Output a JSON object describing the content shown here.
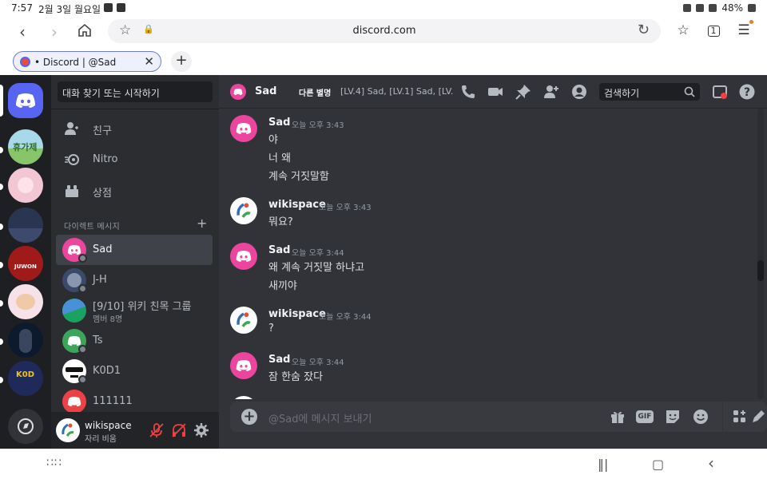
{
  "status_bar": {
    "time": "7:57",
    "date": "2월 3일 월요일",
    "battery": "48%"
  },
  "browser": {
    "url": "discord.com",
    "tab_title": "• Discord | @Sad",
    "tab_count": "1"
  },
  "dm_sidebar": {
    "search_placeholder": "대화 찾기 또는 시작하기",
    "nav": [
      {
        "label": "친구",
        "icon": "friends-icon"
      },
      {
        "label": "Nitro",
        "icon": "nitro-icon"
      },
      {
        "label": "상점",
        "icon": "shop-icon"
      }
    ],
    "dm_header": "다이렉트 메시지",
    "dms": [
      {
        "name": "Sad",
        "sub": "",
        "avatar_color": "#eb459e",
        "active": true
      },
      {
        "name": "J-H",
        "sub": "",
        "avatar_color": "#3b4a6b",
        "active": false
      },
      {
        "name": "[9/10] 위키 친목 그룹",
        "sub": "멤버 8명",
        "avatar_color": "#1aa260",
        "active": false
      },
      {
        "name": "Ts",
        "sub": "",
        "avatar_color": "#3ba55c",
        "active": false
      },
      {
        "name": "K0D1",
        "sub": "",
        "avatar_color": "#ffffff",
        "active": false
      },
      {
        "name": "111111",
        "sub": "",
        "avatar_color": "#ed4245",
        "active": false
      }
    ]
  },
  "user_panel": {
    "name": "wikispace",
    "status": "자리 비움"
  },
  "chat_header": {
    "name": "Sad",
    "aka_label": "다른 별명",
    "nicknames": "[LV.4] Sad, [LV.1] Sad, [LV.0...",
    "search_placeholder": "검색하기"
  },
  "messages": [
    {
      "author": "Sad",
      "time": "오늘 오후 3:43",
      "avatar": "discord",
      "color": "#eb459e",
      "lines": [
        "야",
        "너 왜",
        "계속 거짓말함"
      ]
    },
    {
      "author": "wikispace",
      "time": "오늘 오후 3:43",
      "avatar": "wiki",
      "color": "#ffffff",
      "lines": [
        "뭐요?"
      ]
    },
    {
      "author": "Sad",
      "time": "오늘 오후 3:44",
      "avatar": "discord",
      "color": "#eb459e",
      "lines": [
        "왜 계속 거짓말 하냐고",
        "새끼야"
      ]
    },
    {
      "author": "wikispace",
      "time": "오늘 오후 3:44",
      "avatar": "wiki",
      "color": "#ffffff",
      "lines": [
        "?"
      ]
    },
    {
      "author": "Sad",
      "time": "오늘 오후 3:44",
      "avatar": "discord",
      "color": "#eb459e",
      "lines": [
        "잠 한숨 잤다"
      ]
    }
  ],
  "composer": {
    "placeholder": "@Sad에 메시지 보내기",
    "gif_label": "GIF"
  },
  "colors": {
    "blurple": "#5865f2",
    "sad_pink": "#eb459e",
    "bg": "#313338",
    "sidebar": "#2b2d31",
    "rail": "#1e1f22"
  }
}
